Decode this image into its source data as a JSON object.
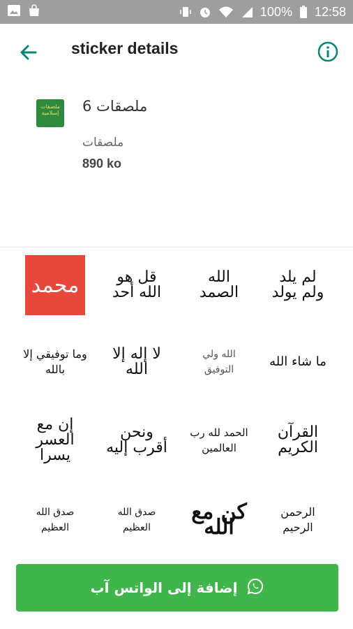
{
  "status_bar": {
    "battery": "100%",
    "time": "12:58"
  },
  "app_bar": {
    "title": "sticker details"
  },
  "pack": {
    "name": "ملصقات 6",
    "publisher": "ملصقات",
    "size": "890 ko",
    "icon_label": "ملصقات إسلامية"
  },
  "stickers": [
    {
      "text": "محمد",
      "style": "red"
    },
    {
      "text": "قل هو الله أحد",
      "style": "calli"
    },
    {
      "text": "الله الصمد",
      "style": "calli"
    },
    {
      "text": "لم يلد ولم يولد",
      "style": "calli"
    },
    {
      "text": "وما توفيقي إلا بالله",
      "style": "calli"
    },
    {
      "text": "لا إله إلا الله",
      "style": "calli"
    },
    {
      "text": "الله ولي التوفيق",
      "style": "calli"
    },
    {
      "text": "ما شاء الله",
      "style": "calli"
    },
    {
      "text": "إن مع العسر يسرا",
      "style": "calli"
    },
    {
      "text": "ونحن أقرب إليه",
      "style": "calli"
    },
    {
      "text": "الحمد لله رب العالمين",
      "style": "calli"
    },
    {
      "text": "القرآن الكريم",
      "style": "calli"
    },
    {
      "text": "صدق الله العظيم",
      "style": "calli"
    },
    {
      "text": "صدق الله العظيم",
      "style": "calli"
    },
    {
      "text": "كن مع الله",
      "style": "calli"
    },
    {
      "text": "الرحمن الرحيم",
      "style": "calli"
    }
  ],
  "add_button": {
    "label": "إضافة إلى الواتس آب"
  },
  "colors": {
    "primary": "#00897b",
    "button": "#3fb54b",
    "status_bar": "#9e9e9e"
  }
}
